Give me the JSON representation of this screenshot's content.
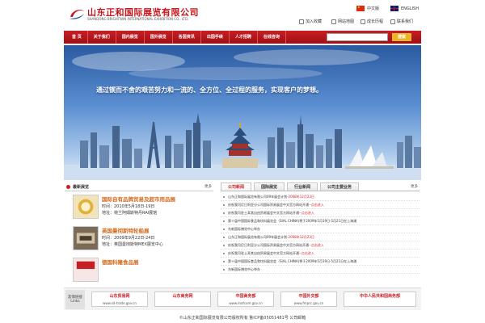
{
  "header": {
    "company_cn": "山东正和国际展览有限公司",
    "company_en": "SHANDONG BRIGHTWIN INTERNATIONAL EXHIBITION CO., LTD.",
    "lang_cn": "中文版",
    "lang_en": "ENGLISH",
    "utils": [
      "加入收藏",
      "网站地图",
      "成长历程",
      "联系我们"
    ]
  },
  "nav": {
    "items": [
      "首 页",
      "关于我们",
      "国内展览",
      "国外展览",
      "各国资讯",
      "出国手续",
      "人才招聘",
      "在线咨询"
    ],
    "search_placeholder": "",
    "search_label": "搜索"
  },
  "banner": {
    "slogan": "通过锲而不舍的艰苦努力和一流的、全方位、全过程的服务，实现客户的梦想。"
  },
  "expos": {
    "title": "最新展览",
    "more": "更多",
    "items": [
      {
        "name": "国际自有品牌贸易及超市用品展",
        "time": "时间：2010年5月18日-19日",
        "addr": "地址：荷兰阿姆斯特丹RAI展馆"
      },
      {
        "name": "英国曼彻斯特轮船展",
        "time": "时间：2009年9月22日-24日",
        "addr": "地址：英国曼彻斯特MEX展览中心"
      },
      {
        "name": "德国科隆食品展",
        "time": "",
        "addr": ""
      }
    ]
  },
  "news": {
    "tabs": [
      "公司新闻",
      "国际展览",
      "行业新闻",
      "公司主要业务"
    ],
    "more": "更多",
    "items": [
      {
        "text": "山东正和国际展览有限公司09年展会计划-",
        "date": "2008年12月23日"
      },
      {
        "text": "庆祝我司尼日利亚分公司国际贸易展会中文官方网站开通",
        "date": "--点击进入"
      },
      {
        "text": "庆祝我司驻土耳其自由贸易展会中文官方网站开通",
        "date": "--点击进入"
      },
      {
        "text": "第十届中国国际食品和饮料展览会（SIAL CHINA)将于2009年5月19日-5月21日在上海浦",
        "date": ""
      },
      {
        "text": "东新国际博览中心举办",
        "date": ""
      },
      {
        "text": "山东正和国际展览有限公司09年展会计划-",
        "date": "2008年12月23日"
      },
      {
        "text": "庆祝我司尼日利亚分公司国际贸易展会中文官方网站开通",
        "date": "--点击进入"
      },
      {
        "text": "庆祝我司驻土耳其自由贸易展会中文官方网站开通",
        "date": "--点击进入"
      },
      {
        "text": "第十届中国国际食品和饮料展览会（SIAL CHINA)将于2009年5月19日-5月21日在上海浦",
        "date": ""
      },
      {
        "text": "东新国际博览中心举办",
        "date": ""
      }
    ]
  },
  "links": {
    "label_cn": "友情链接",
    "label_en": "Links",
    "items": [
      {
        "name": "山东贸易网",
        "sub": "www.sd-trade.gov.cn"
      },
      {
        "name": "山东商务网",
        "sub": ""
      },
      {
        "name": "中国商务部",
        "sub": "www.mofcom.gov.cn"
      },
      {
        "name": "中国外交部",
        "sub": "www.fmprc.gov.cn"
      },
      {
        "name": "中华人民共和国商务部",
        "sub": ""
      }
    ]
  },
  "footer": "©山东正和国际展览有限公司版权所有  鲁ICP备05051481号  公司邮箱"
}
